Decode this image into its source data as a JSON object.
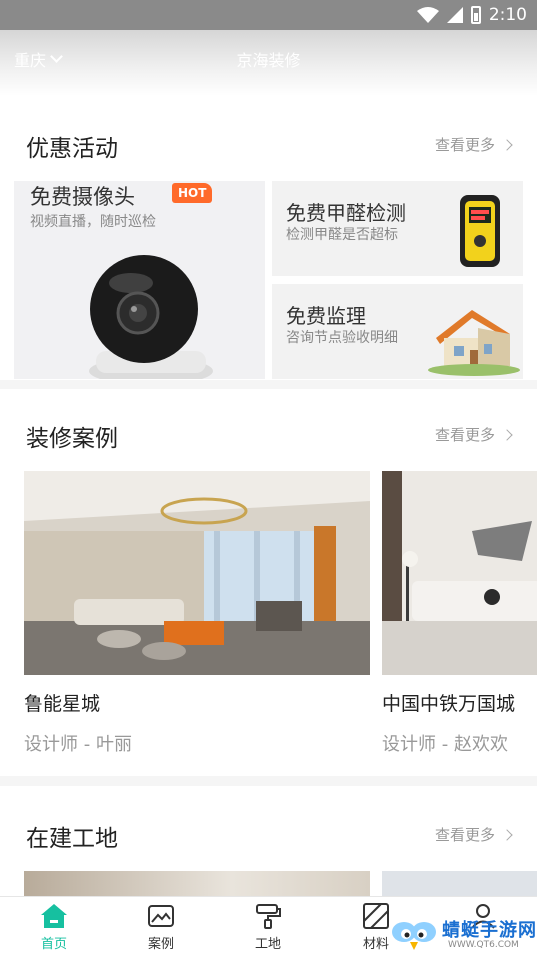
{
  "status_bar": {
    "time": "2:10"
  },
  "header": {
    "city": "重庆",
    "title": "京海装修"
  },
  "promotions": {
    "title": "优惠活动",
    "more": "查看更多",
    "items": [
      {
        "title": "免费摄像头",
        "badge": "HOT",
        "subtitle": "视频直播，随时巡检"
      },
      {
        "title": "免费甲醛检测",
        "subtitle": "检测甲醛是否超标"
      },
      {
        "title": "免费监理",
        "subtitle": "咨询节点验收明细"
      }
    ]
  },
  "cases": {
    "title": "装修案例",
    "more": "查看更多",
    "items": [
      {
        "name": "鲁能星城",
        "designer": "设计师 - 叶丽"
      },
      {
        "name": "中国中铁万国城",
        "designer": "设计师 - 赵欢欢"
      }
    ]
  },
  "sites": {
    "title": "在建工地",
    "more": "查看更多"
  },
  "tabbar": {
    "items": [
      {
        "label": "首页",
        "icon": "home-icon",
        "active": true
      },
      {
        "label": "案例",
        "icon": "gallery-icon"
      },
      {
        "label": "工地",
        "icon": "paint-roller-icon"
      },
      {
        "label": "材料",
        "icon": "material-icon"
      },
      {
        "label": "",
        "icon": "profile-icon"
      }
    ]
  },
  "watermark": {
    "text": "蜻蜓手游网",
    "url": "WWW.QT6.COM"
  },
  "colors": {
    "accent": "#16c0a0",
    "hot": "#ff6a2a"
  }
}
